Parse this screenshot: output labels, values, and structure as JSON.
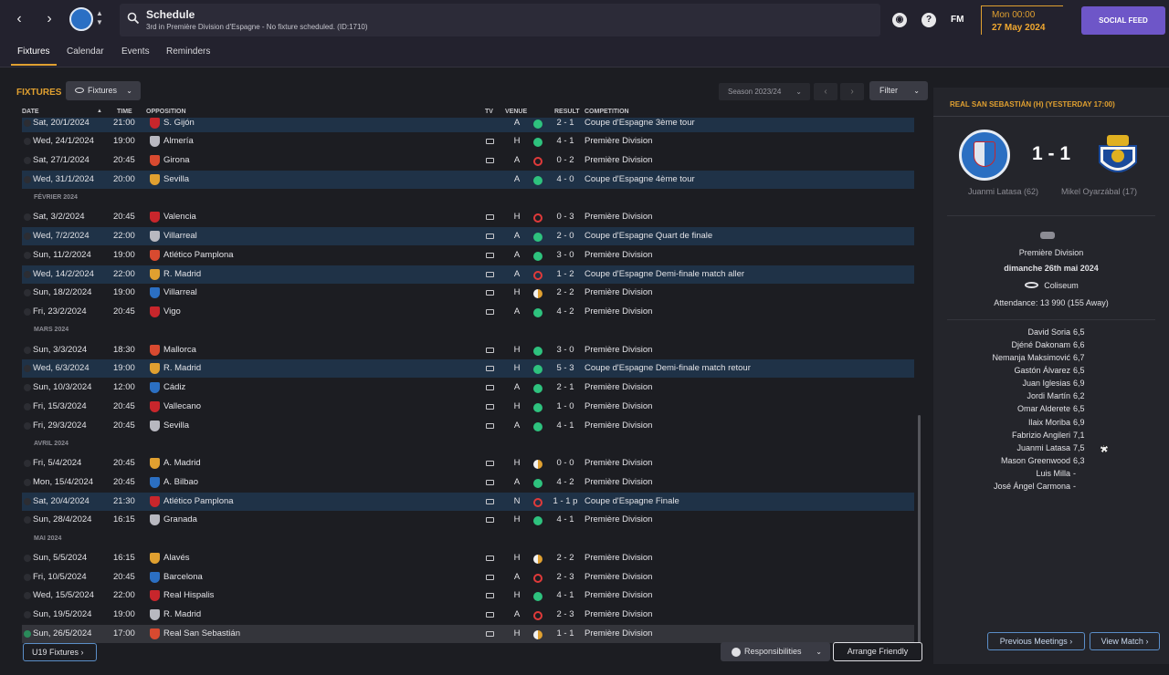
{
  "header": {
    "title": "Schedule",
    "subtitle": "3rd in Première Division d'Espagne - No fixture scheduled. (ID:1710)",
    "fm_label": "FM",
    "help_label": "?",
    "date_time": "Mon 00:00",
    "date_day": "27 May 2024",
    "social_label": "SOCIAL FEED"
  },
  "tabs": [
    {
      "label": "Fixtures"
    },
    {
      "label": "Calendar"
    },
    {
      "label": "Events"
    },
    {
      "label": "Reminders"
    }
  ],
  "fixtures": {
    "section_title": "FIXTURES",
    "dropdown_label": "Fixtures",
    "season_label": "Season 2023/24",
    "filter_label": "Filter",
    "columns": [
      "DATE",
      "TIME",
      "OPPOSITION",
      "TV",
      "VENUE",
      "RESULT",
      "COMPETITION"
    ],
    "rows": [
      {
        "kind": "match",
        "date": "Sat, 20/1/2024",
        "time": "21:00",
        "opp": "S. Gijón",
        "tv": false,
        "venue": "A",
        "outcome": "W",
        "score": "2 - 1",
        "comp": "Coupe d'Espagne 3ème tour",
        "cup": true
      },
      {
        "kind": "match",
        "date": "Wed, 24/1/2024",
        "time": "19:00",
        "opp": "Almería",
        "tv": true,
        "venue": "H",
        "outcome": "W",
        "score": "4 - 1",
        "comp": "Première Division",
        "cup": false
      },
      {
        "kind": "match",
        "date": "Sat, 27/1/2024",
        "time": "20:45",
        "opp": "Girona",
        "tv": true,
        "venue": "A",
        "outcome": "L",
        "score": "0 - 2",
        "comp": "Première Division",
        "cup": false
      },
      {
        "kind": "match",
        "date": "Wed, 31/1/2024",
        "time": "20:00",
        "opp": "Sevilla",
        "tv": false,
        "venue": "A",
        "outcome": "W",
        "score": "4 - 0",
        "comp": "Coupe d'Espagne 4ème tour",
        "cup": true
      },
      {
        "kind": "month",
        "label": "FÉVRIER 2024"
      },
      {
        "kind": "match",
        "date": "Sat, 3/2/2024",
        "time": "20:45",
        "opp": "Valencia",
        "tv": true,
        "venue": "H",
        "outcome": "L",
        "score": "0 - 3",
        "comp": "Première Division",
        "cup": false
      },
      {
        "kind": "match",
        "date": "Wed, 7/2/2024",
        "time": "22:00",
        "opp": "Villarreal",
        "tv": true,
        "venue": "A",
        "outcome": "W",
        "score": "2 - 0",
        "comp": "Coupe d'Espagne Quart de finale",
        "cup": true
      },
      {
        "kind": "match",
        "date": "Sun, 11/2/2024",
        "time": "19:00",
        "opp": "Atlético Pamplona",
        "tv": true,
        "venue": "A",
        "outcome": "W",
        "score": "3 - 0",
        "comp": "Première Division",
        "cup": false
      },
      {
        "kind": "match",
        "date": "Wed, 14/2/2024",
        "time": "22:00",
        "opp": "R. Madrid",
        "tv": true,
        "venue": "A",
        "outcome": "L",
        "score": "1 - 2",
        "comp": "Coupe d'Espagne Demi-finale match aller",
        "cup": true
      },
      {
        "kind": "match",
        "date": "Sun, 18/2/2024",
        "time": "19:00",
        "opp": "Villarreal",
        "tv": true,
        "venue": "H",
        "outcome": "D",
        "score": "2 - 2",
        "comp": "Première Division",
        "cup": false
      },
      {
        "kind": "match",
        "date": "Fri, 23/2/2024",
        "time": "20:45",
        "opp": "Vigo",
        "tv": true,
        "venue": "A",
        "outcome": "W",
        "score": "4 - 2",
        "comp": "Première Division",
        "cup": false
      },
      {
        "kind": "month",
        "label": "MARS 2024"
      },
      {
        "kind": "match",
        "date": "Sun, 3/3/2024",
        "time": "18:30",
        "opp": "Mallorca",
        "tv": true,
        "venue": "H",
        "outcome": "W",
        "score": "3 - 0",
        "comp": "Première Division",
        "cup": false
      },
      {
        "kind": "match",
        "date": "Wed, 6/3/2024",
        "time": "19:00",
        "opp": "R. Madrid",
        "tv": true,
        "venue": "H",
        "outcome": "W",
        "score": "5 - 3",
        "comp": "Coupe d'Espagne Demi-finale match retour",
        "cup": true
      },
      {
        "kind": "match",
        "date": "Sun, 10/3/2024",
        "time": "12:00",
        "opp": "Cádiz",
        "tv": true,
        "venue": "A",
        "outcome": "W",
        "score": "2 - 1",
        "comp": "Première Division",
        "cup": false
      },
      {
        "kind": "match",
        "date": "Fri, 15/3/2024",
        "time": "20:45",
        "opp": "Vallecano",
        "tv": true,
        "venue": "H",
        "outcome": "W",
        "score": "1 - 0",
        "comp": "Première Division",
        "cup": false
      },
      {
        "kind": "match",
        "date": "Fri, 29/3/2024",
        "time": "20:45",
        "opp": "Sevilla",
        "tv": true,
        "venue": "A",
        "outcome": "W",
        "score": "4 - 1",
        "comp": "Première Division",
        "cup": false
      },
      {
        "kind": "month",
        "label": "AVRIL 2024"
      },
      {
        "kind": "match",
        "date": "Fri, 5/4/2024",
        "time": "20:45",
        "opp": "A. Madrid",
        "tv": true,
        "venue": "H",
        "outcome": "D",
        "score": "0 - 0",
        "comp": "Première Division",
        "cup": false
      },
      {
        "kind": "match",
        "date": "Mon, 15/4/2024",
        "time": "20:45",
        "opp": "A. Bilbao",
        "tv": true,
        "venue": "A",
        "outcome": "W",
        "score": "4 - 2",
        "comp": "Première Division",
        "cup": false
      },
      {
        "kind": "match",
        "date": "Sat, 20/4/2024",
        "time": "21:30",
        "opp": "Atlético Pamplona",
        "tv": true,
        "venue": "N",
        "outcome": "L",
        "score": "1 - 1 p",
        "comp": "Coupe d'Espagne Finale",
        "cup": true
      },
      {
        "kind": "match",
        "date": "Sun, 28/4/2024",
        "time": "16:15",
        "opp": "Granada",
        "tv": true,
        "venue": "H",
        "outcome": "W",
        "score": "4 - 1",
        "comp": "Première Division",
        "cup": false
      },
      {
        "kind": "month",
        "label": "MAI 2024"
      },
      {
        "kind": "match",
        "date": "Sun, 5/5/2024",
        "time": "16:15",
        "opp": "Alavés",
        "tv": true,
        "venue": "H",
        "outcome": "D",
        "score": "2 - 2",
        "comp": "Première Division",
        "cup": false
      },
      {
        "kind": "match",
        "date": "Fri, 10/5/2024",
        "time": "20:45",
        "opp": "Barcelona",
        "tv": true,
        "venue": "A",
        "outcome": "L",
        "score": "2 - 3",
        "comp": "Première Division",
        "cup": false
      },
      {
        "kind": "match",
        "date": "Wed, 15/5/2024",
        "time": "22:00",
        "opp": "Real Hispalis",
        "tv": true,
        "venue": "H",
        "outcome": "W",
        "score": "4 - 1",
        "comp": "Première Division",
        "cup": false
      },
      {
        "kind": "match",
        "date": "Sun, 19/5/2024",
        "time": "19:00",
        "opp": "R. Madrid",
        "tv": true,
        "venue": "A",
        "outcome": "L",
        "score": "2 - 3",
        "comp": "Première Division",
        "cup": false
      },
      {
        "kind": "match",
        "date": "Sun, 26/5/2024",
        "time": "17:00",
        "opp": "Real San Sebastián",
        "tv": true,
        "venue": "H",
        "outcome": "D",
        "score": "1 - 1",
        "comp": "Première Division",
        "cup": false,
        "selected": true
      }
    ]
  },
  "footer": {
    "u19_label": "U19 Fixtures",
    "responsibilities_label": "Responsibilities",
    "arrange_label": "Arrange Friendly"
  },
  "match_panel": {
    "title": "REAL SAN SEBASTIÁN (H) (YESTERDAY 17:00)",
    "score": "1 - 1",
    "home_scorer": "Juanmi Latasa (62)",
    "away_scorer": "Mikel Oyarzábal (17)",
    "competition": "Première Division",
    "date": "dimanche 26th mai 2024",
    "stadium": "Coliseum",
    "attendance": "Attendance: 13 990 (155 Away)",
    "players": [
      {
        "name": "David Soria",
        "rating": "6,5"
      },
      {
        "name": "Djéné Dakonam",
        "rating": "6,6"
      },
      {
        "name": "Nemanja Maksimović",
        "rating": "6,7"
      },
      {
        "name": "Gastón Álvarez",
        "rating": "6,5"
      },
      {
        "name": "Juan Iglesias",
        "rating": "6,9"
      },
      {
        "name": "Jordi Martín",
        "rating": "6,2"
      },
      {
        "name": "Omar Alderete",
        "rating": "6,5"
      },
      {
        "name": "Ilaix Moriba",
        "rating": "6,9"
      },
      {
        "name": "Fabrizio Angileri",
        "rating": "7,1"
      },
      {
        "name": "Juanmi Latasa",
        "rating": "7,5"
      },
      {
        "name": "Mason Greenwood",
        "rating": "6,3"
      },
      {
        "name": "Luis Milla",
        "rating": "-"
      },
      {
        "name": "José Ángel Carmona",
        "rating": "-"
      }
    ],
    "prev_label": "Previous Meetings",
    "view_label": "View Match"
  },
  "colors": {
    "accent": "#e0a030",
    "cup_row": "#1f3247",
    "win": "#2ec27e",
    "loss": "#e03a3a",
    "social": "#6e56c8"
  }
}
